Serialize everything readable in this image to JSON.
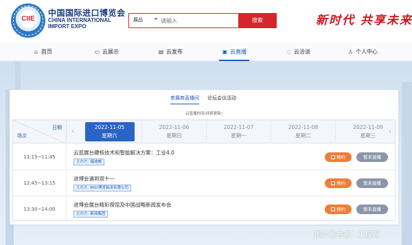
{
  "logo": {
    "emblem_text": "CIIE",
    "cn_name": "中国国际进口博览会",
    "en_lines": [
      "CHINA INTERNATIONAL",
      "IMPORT EXPO"
    ]
  },
  "search": {
    "category": "展品",
    "placeholder": "请输入",
    "button_label": "搜索"
  },
  "slogan": "新时代 共享未来",
  "nav": [
    {
      "label": "首页",
      "icon": "home-icon",
      "glyph": "⌂"
    },
    {
      "label": "云展示",
      "icon": "display-icon",
      "glyph": "▭"
    },
    {
      "label": "云发布",
      "icon": "publish-icon",
      "glyph": "▤"
    },
    {
      "label": "云直播",
      "icon": "live-icon",
      "glyph": "▣"
    },
    {
      "label": "云洽谈",
      "icon": "chat-icon",
      "glyph": "◌"
    },
    {
      "label": "个人中心",
      "icon": "user-icon",
      "glyph": "♙"
    }
  ],
  "nav_active": "云直播",
  "tabs": [
    "参展商直播间",
    "论坛会议活动"
  ],
  "subtitle": "云直播时间(持续更新)",
  "table": {
    "corner_date": "日期",
    "corner_slot": "场次",
    "days": [
      {
        "date": "2022-11-05",
        "weekday": "星期六",
        "active": true
      },
      {
        "date": "2022-11-06",
        "weekday": "星期日"
      },
      {
        "date": "2022-11-07",
        "weekday": "星期一"
      },
      {
        "date": "2022-11-08",
        "weekday": "星期二"
      },
      {
        "date": "2022-11-09",
        "weekday": "星期三"
      }
    ],
    "rows": [
      {
        "time": "11:15~11:45",
        "title": "云逛展台硬核技术和智能解决方案：工业4.0",
        "host_label": "主办方",
        "host": "福迪威",
        "reserve": "预约",
        "status": "暂未直播"
      },
      {
        "time": "12:45~13:15",
        "title": "进博会遇到双十一",
        "host_label": "主办方",
        "host": "BKD博肯铂泽有限公司",
        "reserve": "预约",
        "status": "暂未直播"
      },
      {
        "time": "13:30~14:00",
        "title": "进博会展台精彩探馆及中国战略新闻发布会",
        "host_label": "主办方",
        "host": "新闻集团",
        "reserve": "预约",
        "status": "暂未直播"
      }
    ]
  },
  "watermark": "图片发布者：工控网",
  "colors": {
    "brand_red": "#d7262b",
    "accent_blue": "#2a64c4",
    "reserve_orange": "#f07d38",
    "status_gray": "#8a96a8"
  }
}
